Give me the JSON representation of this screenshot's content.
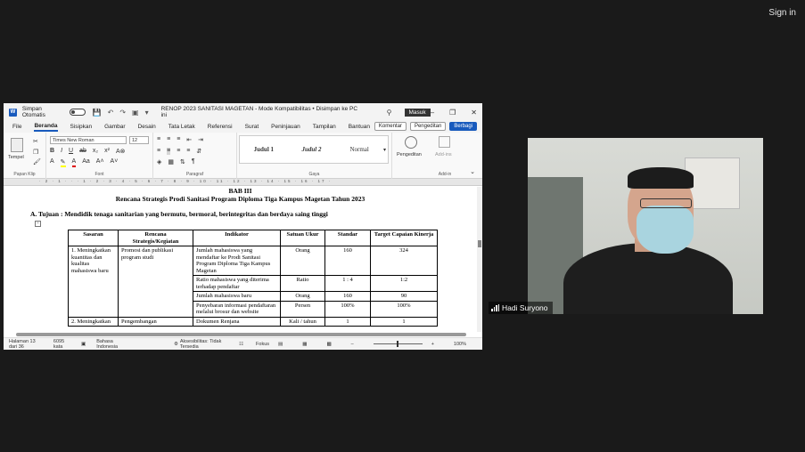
{
  "meeting": {
    "signin": "Sign in"
  },
  "word": {
    "autosave_label": "Simpan Otomatis",
    "title": "RENOP 2023 SANITASI MAGETAN  -  Mode Kompatibilitas  •  Disimpan ke PC ini",
    "login": "Masuk",
    "tabs": [
      "File",
      "Beranda",
      "Sisipkan",
      "Gambar",
      "Desain",
      "Tata Letak",
      "Referensi",
      "Surat",
      "Peninjauan",
      "Tampilan",
      "Bantuan"
    ],
    "comment_btn": "Komentar",
    "editing_btn": "Pengeditan",
    "share_btn": "Berbagi",
    "ribbon": {
      "paste": "Tempel",
      "clipboard": "Papan Klip",
      "font_name": "Times New Roman",
      "font_size": "12",
      "font_group": "Font",
      "paragraph_group": "Paragraf",
      "styles": [
        "Judul 1",
        "Judul 2",
        "Normal"
      ],
      "styles_group": "Gaya",
      "editing": "Pengeditan",
      "addin": "Add-ins",
      "addin_group": "Add-in"
    },
    "ruler": "· 2 · 1 · · · 1 · 2 · 3 · 4 · 5 · 6 · 7 · 8 · 9 · 10 · 11 · 12 · 13 · 14 · 15 · 16 · 17 ·",
    "status": {
      "page": "Halaman 13 dari 36",
      "words": "6095 kata",
      "lang": "Bahasa Indonesia",
      "access": "Aksesibilitas: Tidak Tersedia",
      "focus": "Fokus",
      "zoom": "100%"
    }
  },
  "doc": {
    "bab": "BAB III",
    "title": "Rencana Strategis Prodi Sanitasi Program Diploma Tiga Kampus Magetan Tahun 2023",
    "tujuan": "A.   Tujuan : Mendidik tenaga sanitarian yang bermutu, bermoral, berintegritas dan berdaya saing tinggi",
    "headers": [
      "Sasaran",
      "Rencana Strategis/Kegiatan",
      "Indikator",
      "Satuan Ukur",
      "Standar",
      "Target Capaian Kinerja"
    ],
    "sasaran": "1. Meningkatkan kuantitas dan kualitas mahasiswa baru",
    "kegiatan": "Promosi dan publikasi program studi",
    "rows": [
      {
        "indikator": "Jumlah mahasiswa yang mendaftar ke Prodi Sanitasi Program Diploma Tiga Kampus Magetan",
        "satuan": "Orang",
        "standar": "160",
        "target": "324"
      },
      {
        "indikator": "Ratio mahasiswa yang diterima terhadap pendaftar",
        "satuan": "Ratio",
        "standar": "1 : 4",
        "target": "1:2"
      },
      {
        "indikator": "Jumlah mahasiswa baru",
        "satuan": "Orang",
        "standar": "160",
        "target": "90"
      },
      {
        "indikator": "Penyebaran informasi pendaftaran melalui brosur dan website",
        "satuan": "Persen",
        "standar": "100%",
        "target": "100%"
      }
    ],
    "next_sasaran": "2. Meningkatkan",
    "next_kegiatan": "Pengembangan",
    "next_indikator": "Dokumen Renjana",
    "next_satuan": "Kali / tahun",
    "next_standar": "1",
    "next_target": "1"
  },
  "participant": {
    "name": "Hadi Suryono"
  }
}
